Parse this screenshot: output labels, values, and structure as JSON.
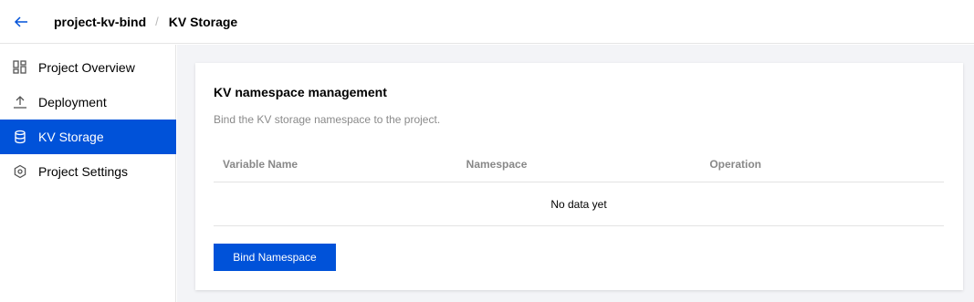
{
  "header": {
    "back_icon": "arrow-left-icon",
    "project_name": "project-kv-bind",
    "separator": "/",
    "current_page": "KV Storage",
    "accent": "#0052d9"
  },
  "sidebar": {
    "items": [
      {
        "label": "Project Overview",
        "icon": "dashboard-icon",
        "active": false
      },
      {
        "label": "Deployment",
        "icon": "upload-icon",
        "active": false
      },
      {
        "label": "KV Storage",
        "icon": "database-icon",
        "active": true
      },
      {
        "label": "Project Settings",
        "icon": "settings-icon",
        "active": false
      }
    ]
  },
  "card": {
    "title": "KV namespace management",
    "description": "Bind the KV storage namespace to the project.",
    "table": {
      "columns": [
        "Variable Name",
        "Namespace",
        "Operation"
      ],
      "rows": [],
      "empty_text": "No data yet"
    },
    "bind_button_label": "Bind Namespace"
  }
}
